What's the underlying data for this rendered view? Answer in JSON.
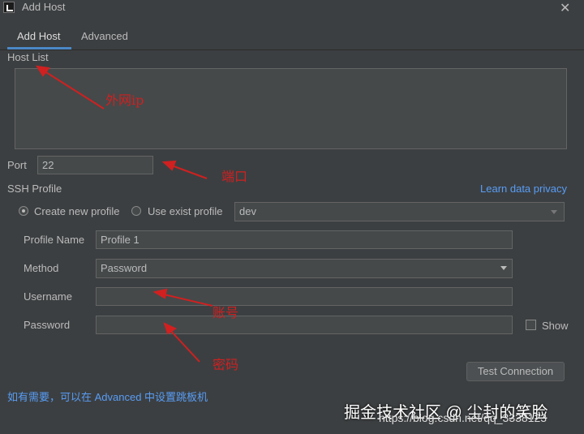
{
  "window": {
    "title": "Add Host",
    "close_icon": "close-icon"
  },
  "tabs": [
    {
      "label": "Add Host"
    },
    {
      "label": "Advanced"
    }
  ],
  "host_list": {
    "label": "Host List",
    "value": ""
  },
  "port": {
    "label": "Port",
    "value": "22"
  },
  "ssh_profile": {
    "label": "SSH Profile",
    "learn_link": "Learn data privacy",
    "create_new": "Create new profile",
    "use_exist": "Use exist profile",
    "existing_profile": "dev",
    "selected_option": "create_new"
  },
  "profile": {
    "name_label": "Profile Name",
    "name_value": "Profile 1",
    "method_label": "Method",
    "method_value": "Password",
    "username_label": "Username",
    "username_value": "",
    "password_label": "Password",
    "password_value": "",
    "show_label": "Show"
  },
  "buttons": {
    "test_connection": "Test Connection"
  },
  "footer": {
    "hint": "如有需要，可以在 Advanced 中设置跳板机"
  },
  "annotations": {
    "host": "外网ip",
    "port": "端口",
    "username": "账号",
    "password": "密码"
  },
  "watermark": {
    "text": "掘金技术社区 @ 尘封的笑脸",
    "url": "https://blog.csdn.net/qq_3338123"
  },
  "colors": {
    "background": "#3c3f41",
    "accent": "#4a88c7",
    "link": "#589df6",
    "annotation": "#d02020"
  }
}
